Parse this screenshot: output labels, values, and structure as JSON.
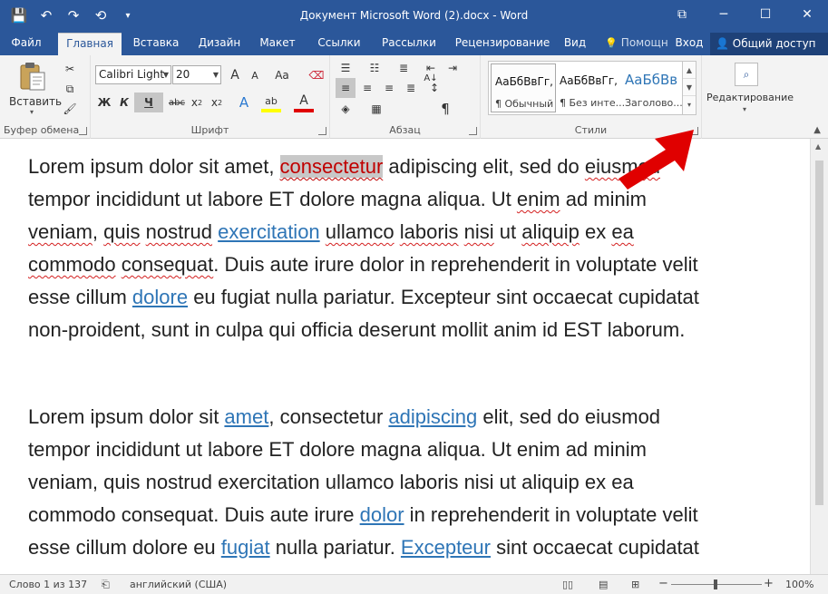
{
  "titlebar": {
    "title": "Документ Microsoft Word (2).docx  -  Word",
    "save_icon": "💾",
    "undo_icon": "↶",
    "redo_icon": "↷",
    "format_icon": "⟲",
    "more_icon": "▾",
    "ribbon_display_icon": "⧉",
    "minimize_icon": "─",
    "maximize_icon": "☐",
    "close_icon": "✕"
  },
  "tabs": {
    "file": "Файл",
    "home": "Главная",
    "insert": "Вставка",
    "design": "Дизайн",
    "layout": "Макет",
    "references": "Ссылки",
    "mailings": "Рассылки",
    "review": "Рецензирование",
    "view": "Вид",
    "tell_me": "Помощн",
    "signin": "Вход",
    "share": "Общий доступ"
  },
  "ribbon": {
    "clipboard": {
      "label": "Буфер обмена",
      "paste": "Вставить",
      "paste_arrow": "▾"
    },
    "font": {
      "label": "Шрифт",
      "font_name": "Calibri Light",
      "font_size": "20",
      "grow": "A",
      "shrink": "A",
      "case": "Aa",
      "bold": "Ж",
      "italic": "К",
      "underline": "Ч",
      "strike": "abc",
      "subscript": "x",
      "superscript": "x",
      "sub_mark": "2",
      "sup_mark": "2",
      "effects": "A",
      "highlight": "ab",
      "color": "A"
    },
    "paragraph": {
      "label": "Абзац",
      "pilcrow": "¶",
      "sort": "A↓"
    },
    "styles": {
      "label": "Стили",
      "items": [
        {
          "sample": "АаБбВвГг,",
          "name": "¶ Обычный"
        },
        {
          "sample": "АаБбВвГг,",
          "name": "¶ Без инте..."
        },
        {
          "sample": "АаБбВв",
          "name": "Заголово..."
        }
      ]
    },
    "editing": {
      "label": "Редактирование",
      "arrow": "▾"
    }
  },
  "document": {
    "para1": [
      [
        {
          "t": "Lorem ipsum dolor sit amet, "
        },
        {
          "t": "consectetur",
          "s": "sel"
        },
        {
          "t": " adipiscing elit, sed do "
        },
        {
          "t": "eiusmod",
          "s": "sq"
        }
      ],
      [
        {
          "t": "tempor incididunt ut labore ET dolore magna aliqua. Ut "
        },
        {
          "t": "enim",
          "s": "sq"
        },
        {
          "t": " ad minim"
        }
      ],
      [
        {
          "t": "veniam",
          "s": "sq"
        },
        {
          "t": ", "
        },
        {
          "t": "quis",
          "s": "sq"
        },
        {
          "t": " "
        },
        {
          "t": "nostrud",
          "s": "sq"
        },
        {
          "t": " "
        },
        {
          "t": "exercitation",
          "s": "link"
        },
        {
          "t": " "
        },
        {
          "t": "ullamco",
          "s": "sq"
        },
        {
          "t": " "
        },
        {
          "t": "laboris",
          "s": "sq"
        },
        {
          "t": " "
        },
        {
          "t": "nisi",
          "s": "sq"
        },
        {
          "t": " ut "
        },
        {
          "t": "aliquip",
          "s": "sq"
        },
        {
          "t": " ex "
        },
        {
          "t": "ea",
          "s": "sq"
        }
      ],
      [
        {
          "t": "commodo",
          "s": "sq"
        },
        {
          "t": " "
        },
        {
          "t": "consequat",
          "s": "sq"
        },
        {
          "t": ". Duis aute irure dolor in reprehenderit in voluptate velit"
        }
      ],
      [
        {
          "t": "esse cillum "
        },
        {
          "t": "dolore",
          "s": "link"
        },
        {
          "t": " eu fugiat nulla pariatur. Excepteur sint occaecat cupidatat"
        }
      ],
      [
        {
          "t": "non-proident, sunt in culpa qui officia deserunt mollit anim id EST laborum."
        }
      ]
    ],
    "para2": [
      [
        {
          "t": "Lorem ipsum dolor sit "
        },
        {
          "t": "amet",
          "s": "link"
        },
        {
          "t": ", consectetur "
        },
        {
          "t": "adipiscing",
          "s": "link"
        },
        {
          "t": " elit, sed do eiusmod"
        }
      ],
      [
        {
          "t": "tempor incididunt ut labore ET dolore magna aliqua. Ut enim ad minim"
        }
      ],
      [
        {
          "t": "veniam, quis nostrud exercitation ullamco laboris nisi ut aliquip ex ea"
        }
      ],
      [
        {
          "t": "commodo consequat. Duis aute irure "
        },
        {
          "t": "dolor",
          "s": "link"
        },
        {
          "t": " in reprehenderit in voluptate velit"
        }
      ],
      [
        {
          "t": "esse cillum dolore eu "
        },
        {
          "t": "fugiat",
          "s": "link"
        },
        {
          "t": " nulla pariatur. "
        },
        {
          "t": "Excepteur",
          "s": "link"
        },
        {
          "t": " sint occaecat cupidatat"
        }
      ]
    ]
  },
  "statusbar": {
    "words": "Слово 1 из 137",
    "language": "английский (США)",
    "zoom": "100%",
    "zoom_minus": "−",
    "zoom_plus": "+"
  },
  "colors": {
    "accent": "#2b579a",
    "link": "#2e75b6",
    "arrow": "#e00000"
  }
}
